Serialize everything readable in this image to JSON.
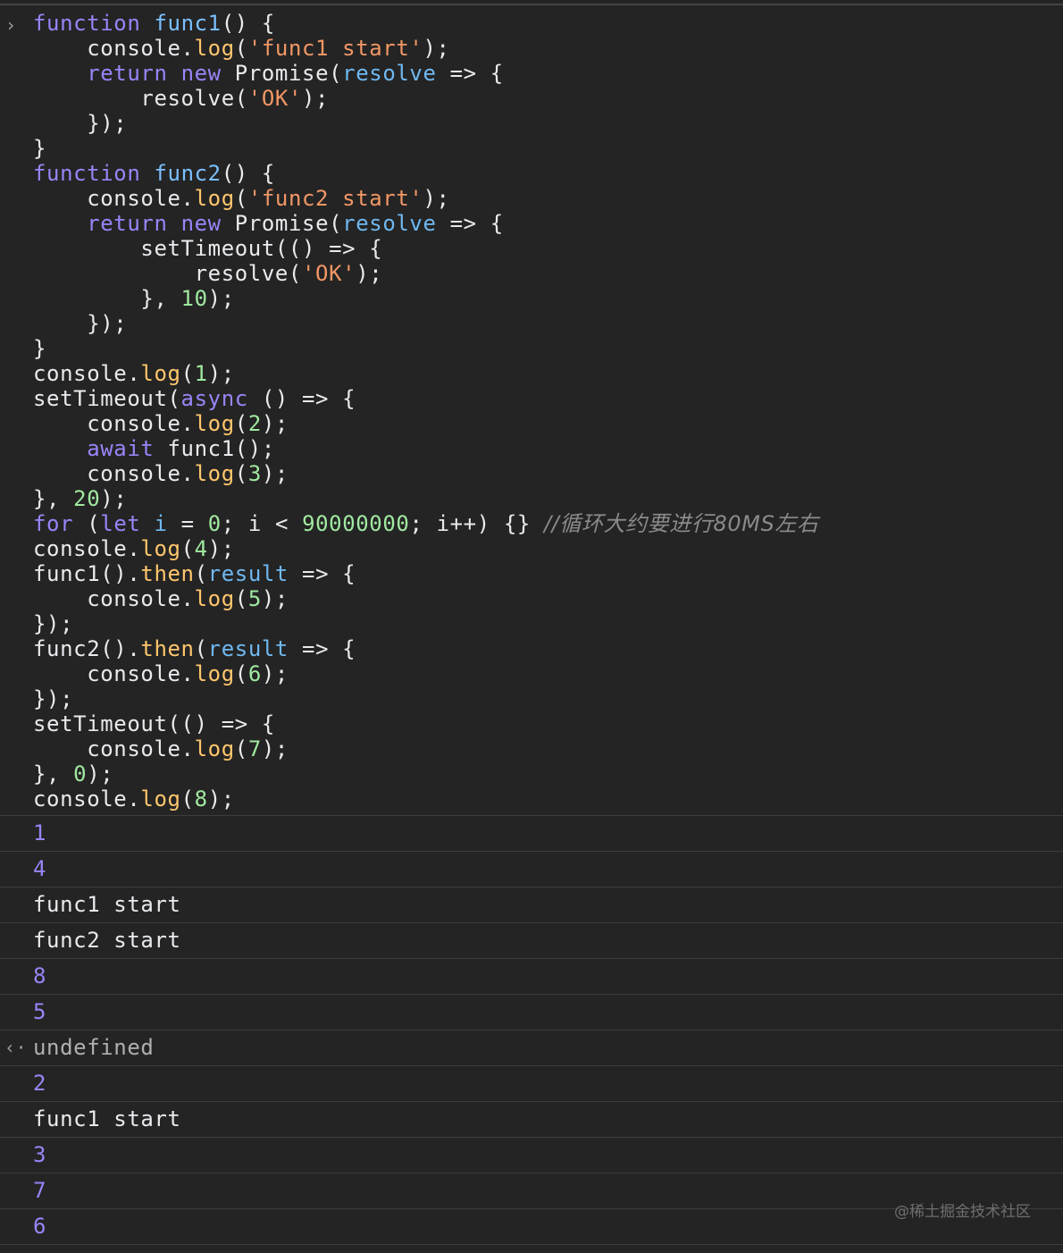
{
  "console": {
    "prompt_icon": "chevron-right-icon",
    "code_lines": [
      [
        [
          "keyword",
          "function"
        ],
        [
          "plain",
          " "
        ],
        [
          "fn",
          "func1"
        ],
        [
          "plain",
          "() {"
        ]
      ],
      [
        [
          "plain",
          "    console."
        ],
        [
          "method",
          "log"
        ],
        [
          "plain",
          "("
        ],
        [
          "string",
          "'func1 start'"
        ],
        [
          "plain",
          ");"
        ]
      ],
      [
        [
          "plain",
          "    "
        ],
        [
          "keyword",
          "return"
        ],
        [
          "plain",
          " "
        ],
        [
          "keyword",
          "new"
        ],
        [
          "plain",
          " Promise("
        ],
        [
          "param",
          "resolve"
        ],
        [
          "plain",
          " => {"
        ]
      ],
      [
        [
          "plain",
          "        resolve("
        ],
        [
          "string",
          "'OK'"
        ],
        [
          "plain",
          ");"
        ]
      ],
      [
        [
          "plain",
          "    });"
        ]
      ],
      [
        [
          "plain",
          "}"
        ]
      ],
      [
        [
          "keyword",
          "function"
        ],
        [
          "plain",
          " "
        ],
        [
          "fn",
          "func2"
        ],
        [
          "plain",
          "() {"
        ]
      ],
      [
        [
          "plain",
          "    console."
        ],
        [
          "method",
          "log"
        ],
        [
          "plain",
          "("
        ],
        [
          "string",
          "'func2 start'"
        ],
        [
          "plain",
          ");"
        ]
      ],
      [
        [
          "plain",
          "    "
        ],
        [
          "keyword",
          "return"
        ],
        [
          "plain",
          " "
        ],
        [
          "keyword",
          "new"
        ],
        [
          "plain",
          " Promise("
        ],
        [
          "param",
          "resolve"
        ],
        [
          "plain",
          " => {"
        ]
      ],
      [
        [
          "plain",
          "        setTimeout(() => {"
        ]
      ],
      [
        [
          "plain",
          "            resolve("
        ],
        [
          "string",
          "'OK'"
        ],
        [
          "plain",
          ");"
        ]
      ],
      [
        [
          "plain",
          "        }, "
        ],
        [
          "number",
          "10"
        ],
        [
          "plain",
          ");"
        ]
      ],
      [
        [
          "plain",
          "    });"
        ]
      ],
      [
        [
          "plain",
          "}"
        ]
      ],
      [
        [
          "plain",
          "console."
        ],
        [
          "method",
          "log"
        ],
        [
          "plain",
          "("
        ],
        [
          "number",
          "1"
        ],
        [
          "plain",
          ");"
        ]
      ],
      [
        [
          "plain",
          "setTimeout("
        ],
        [
          "keyword",
          "async"
        ],
        [
          "plain",
          " () => {"
        ]
      ],
      [
        [
          "plain",
          "    console."
        ],
        [
          "method",
          "log"
        ],
        [
          "plain",
          "("
        ],
        [
          "number",
          "2"
        ],
        [
          "plain",
          ");"
        ]
      ],
      [
        [
          "plain",
          "    "
        ],
        [
          "keyword",
          "await"
        ],
        [
          "plain",
          " func1();"
        ]
      ],
      [
        [
          "plain",
          "    console."
        ],
        [
          "method",
          "log"
        ],
        [
          "plain",
          "("
        ],
        [
          "number",
          "3"
        ],
        [
          "plain",
          ");"
        ]
      ],
      [
        [
          "plain",
          "}, "
        ],
        [
          "number",
          "20"
        ],
        [
          "plain",
          ");"
        ]
      ],
      [
        [
          "keyword",
          "for"
        ],
        [
          "plain",
          " ("
        ],
        [
          "keyword",
          "let"
        ],
        [
          "plain",
          " "
        ],
        [
          "param",
          "i"
        ],
        [
          "plain",
          " = "
        ],
        [
          "number",
          "0"
        ],
        [
          "plain",
          "; i < "
        ],
        [
          "number",
          "90000000"
        ],
        [
          "plain",
          "; i++) {} "
        ],
        [
          "comment",
          "//循环大约要进行80MS左右"
        ]
      ],
      [
        [
          "plain",
          "console."
        ],
        [
          "method",
          "log"
        ],
        [
          "plain",
          "("
        ],
        [
          "number",
          "4"
        ],
        [
          "plain",
          ");"
        ]
      ],
      [
        [
          "plain",
          "func1()."
        ],
        [
          "method",
          "then"
        ],
        [
          "plain",
          "("
        ],
        [
          "param",
          "result"
        ],
        [
          "plain",
          " => {"
        ]
      ],
      [
        [
          "plain",
          "    console."
        ],
        [
          "method",
          "log"
        ],
        [
          "plain",
          "("
        ],
        [
          "number",
          "5"
        ],
        [
          "plain",
          ");"
        ]
      ],
      [
        [
          "plain",
          "});"
        ]
      ],
      [
        [
          "plain",
          "func2()."
        ],
        [
          "method",
          "then"
        ],
        [
          "plain",
          "("
        ],
        [
          "param",
          "result"
        ],
        [
          "plain",
          " => {"
        ]
      ],
      [
        [
          "plain",
          "    console."
        ],
        [
          "method",
          "log"
        ],
        [
          "plain",
          "("
        ],
        [
          "number",
          "6"
        ],
        [
          "plain",
          ");"
        ]
      ],
      [
        [
          "plain",
          "});"
        ]
      ],
      [
        [
          "plain",
          "setTimeout(() => {"
        ]
      ],
      [
        [
          "plain",
          "    console."
        ],
        [
          "method",
          "log"
        ],
        [
          "plain",
          "("
        ],
        [
          "number",
          "7"
        ],
        [
          "plain",
          ");"
        ]
      ],
      [
        [
          "plain",
          "}, "
        ],
        [
          "number",
          "0"
        ],
        [
          "plain",
          ");"
        ]
      ],
      [
        [
          "plain",
          "console."
        ],
        [
          "method",
          "log"
        ],
        [
          "plain",
          "("
        ],
        [
          "number",
          "8"
        ],
        [
          "plain",
          ");"
        ]
      ]
    ],
    "outputs": [
      {
        "text": "1",
        "kind": "number"
      },
      {
        "text": "4",
        "kind": "number"
      },
      {
        "text": "func1 start",
        "kind": "text"
      },
      {
        "text": "func2 start",
        "kind": "text"
      },
      {
        "text": "8",
        "kind": "number"
      },
      {
        "text": "5",
        "kind": "number"
      },
      {
        "text": "undefined",
        "kind": "return",
        "icon": "return-arrow-icon"
      },
      {
        "text": "2",
        "kind": "number"
      },
      {
        "text": "func1 start",
        "kind": "text"
      },
      {
        "text": "3",
        "kind": "number"
      },
      {
        "text": "7",
        "kind": "number"
      },
      {
        "text": "6",
        "kind": "number"
      }
    ]
  },
  "watermark": "@稀土掘金技术社区",
  "colors": {
    "background": "#242424",
    "keyword": "#9a84f7",
    "string": "#f29766",
    "number": "#a0e8a0",
    "method": "#ffc66d"
  }
}
